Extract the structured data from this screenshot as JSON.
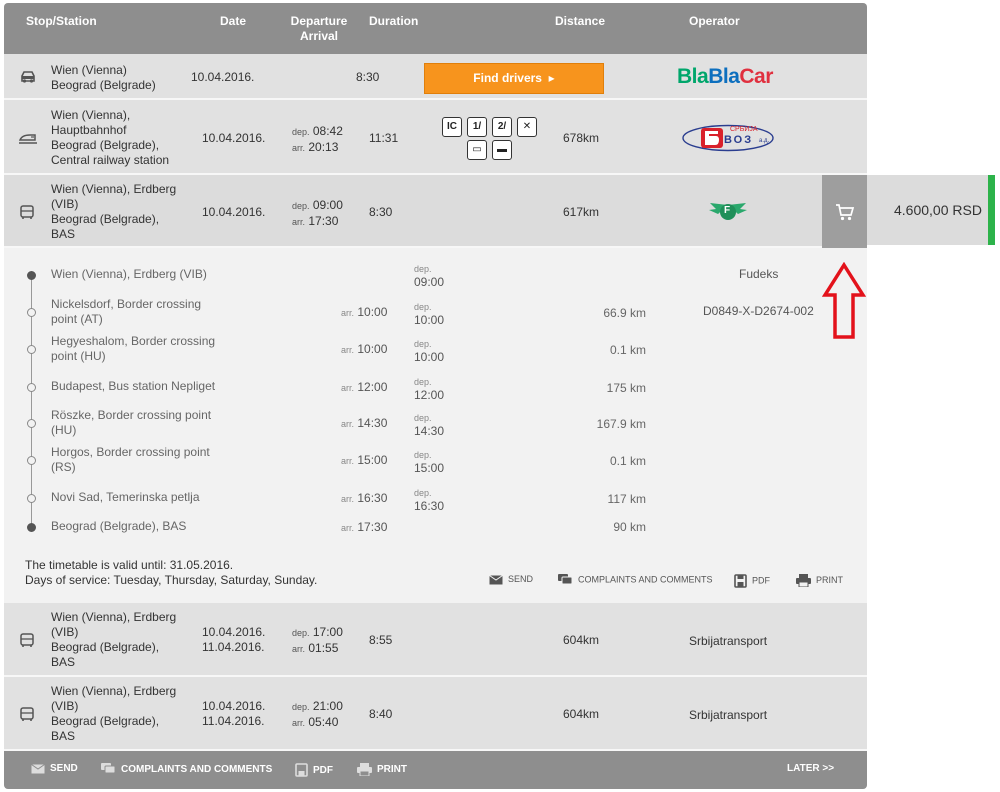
{
  "header": {
    "stop": "Stop/Station",
    "date": "Date",
    "departure": "Departure",
    "arrival": "Arrival",
    "duration": "Duration",
    "distance": "Distance",
    "operator": "Operator"
  },
  "rows": [
    {
      "icon": "car-icon",
      "station_lines": [
        "Wien (Vienna)",
        "Beograd (Belgrade)"
      ],
      "dates": [
        "10.04.2016."
      ],
      "departure": "8:30",
      "button": "Find drivers",
      "operator_logo": "BlaBlaCar",
      "logo_parts": [
        "Bla",
        "Bla",
        "Car"
      ]
    },
    {
      "icon": "train-icon",
      "station_lines": [
        "Wien (Vienna),",
        "Hauptbahnhof",
        "Beograd (Belgrade),",
        "Central railway station"
      ],
      "dates": [
        "10.04.2016."
      ],
      "dep_label": "dep.",
      "arr_label": "arr.",
      "dep": "08:42",
      "arr": "20:13",
      "duration": "11:31",
      "distance": "678km",
      "amenities": [
        "IC",
        "1/",
        "2/",
        "restaurant",
        "sleeper",
        "couchette"
      ],
      "operator_logo": "Srbija Voz",
      "logo_small": "СРБИЈА",
      "logo_big": "ВОЗ",
      "logo_suffix": "а.д."
    },
    {
      "icon": "bus-icon",
      "station_lines": [
        "Wien (Vienna), Erdberg",
        "(VIB)",
        "Beograd (Belgrade),",
        "BAS"
      ],
      "dates": [
        "10.04.2016."
      ],
      "dep_label": "dep.",
      "arr_label": "arr.",
      "dep": "09:00",
      "arr": "17:30",
      "duration": "8:30",
      "distance": "617km",
      "operator_logo": "Fudeks",
      "logo_letter": "F",
      "price": "4.600,00 RSD"
    },
    {
      "icon": "bus-icon",
      "station_lines": [
        "Wien (Vienna), Erdberg",
        "(VIB)",
        "Beograd (Belgrade),",
        "BAS"
      ],
      "dates": [
        "10.04.2016.",
        "11.04.2016."
      ],
      "dep_label": "dep.",
      "arr_label": "arr.",
      "dep": "17:00",
      "arr": "01:55",
      "duration": "8:55",
      "distance": "604km",
      "operator": "Srbijatransport"
    },
    {
      "icon": "bus-icon",
      "station_lines": [
        "Wien (Vienna), Erdberg",
        "(VIB)",
        "Beograd (Belgrade),",
        "BAS"
      ],
      "dates": [
        "10.04.2016.",
        "11.04.2016."
      ],
      "dep_label": "dep.",
      "arr_label": "arr.",
      "dep": "21:00",
      "arr": "05:40",
      "duration": "8:40",
      "distance": "604km",
      "operator": "Srbijatransport"
    }
  ],
  "detail": {
    "operator": "Fudeks",
    "code": "D0849-X-D2674-002",
    "arr_label": "arr.",
    "dep_label": "dep.",
    "stops": [
      {
        "name": [
          "Wien (Vienna), Erdberg (VIB)"
        ],
        "arr": "",
        "dep": "09:00",
        "dist": ""
      },
      {
        "name": [
          "Nickelsdorf, Border crossing",
          "point (AT)"
        ],
        "arr": "10:00",
        "dep": "10:00",
        "dist": "66.9 km"
      },
      {
        "name": [
          "Hegyeshalom, Border crossing",
          "point (HU)"
        ],
        "arr": "10:00",
        "dep": "10:00",
        "dist": "0.1 km"
      },
      {
        "name": [
          "Budapest, Bus station Nepliget"
        ],
        "arr": "12:00",
        "dep": "12:00",
        "dist": "175 km"
      },
      {
        "name": [
          "Röszke, Border crossing point",
          "(HU)"
        ],
        "arr": "14:30",
        "dep": "14:30",
        "dist": "167.9 km"
      },
      {
        "name": [
          "Horgos, Border crossing point",
          "(RS)"
        ],
        "arr": "15:00",
        "dep": "15:00",
        "dist": "0.1 km"
      },
      {
        "name": [
          "Novi Sad, Temerinska petlja"
        ],
        "arr": "16:30",
        "dep": "16:30",
        "dist": "117 km"
      },
      {
        "name": [
          "Beograd (Belgrade), BAS"
        ],
        "arr": "17:30",
        "dep": "",
        "dist": "90 km"
      }
    ],
    "validity": "The timetable is valid until: 31.05.2016.",
    "days": "Days of service: Tuesday, Thursday, Saturday, Sunday.",
    "actions": {
      "send": "SEND",
      "complaints": "COMPLAINTS AND COMMENTS",
      "pdf": "PDF",
      "print": "PRINT"
    }
  },
  "footer": {
    "send": "SEND",
    "complaints": "COMPLAINTS AND COMMENTS",
    "pdf": "PDF",
    "print": "PRINT",
    "later": "LATER >>"
  },
  "colors": {
    "header": "#8e8e8e",
    "button": "#f7941d",
    "price_bar": "#2db34a",
    "arrow": "#e3121b"
  }
}
